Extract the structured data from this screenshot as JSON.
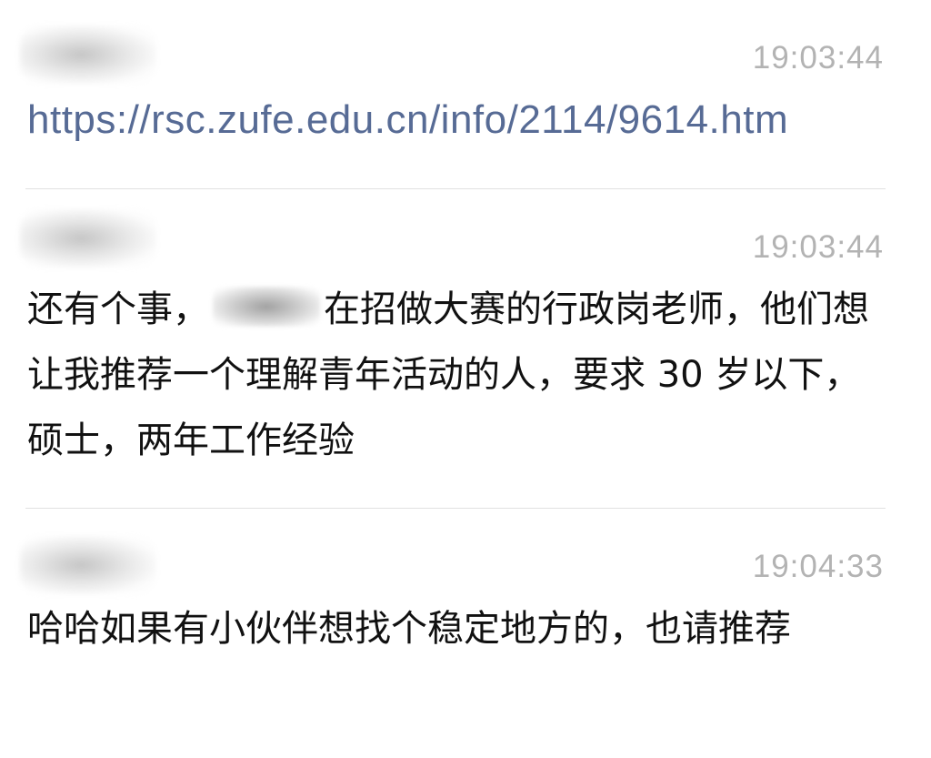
{
  "messages": [
    {
      "sender": "",
      "time": "19:03:44",
      "text": "https://rsc.zufe.edu.cn/info/2114/9614.htm",
      "is_link": true
    },
    {
      "sender": "",
      "time": "19:03:44",
      "text_before_redaction": "还有个事，",
      "text_after_redaction": "在招做大赛的行政岗老师，他们想让我推荐一个理解青年活动的人，要求 30 岁以下，硕士，两年工作经验",
      "is_link": false
    },
    {
      "sender": "",
      "time": "19:04:33",
      "text": "哈哈如果有小伙伴想找个稳定地方的，也请推荐",
      "is_link": false
    }
  ],
  "colors": {
    "link": "#576b95",
    "timestamp": "#b3b3b3",
    "text": "#111111",
    "divider": "#e1e1e1"
  }
}
